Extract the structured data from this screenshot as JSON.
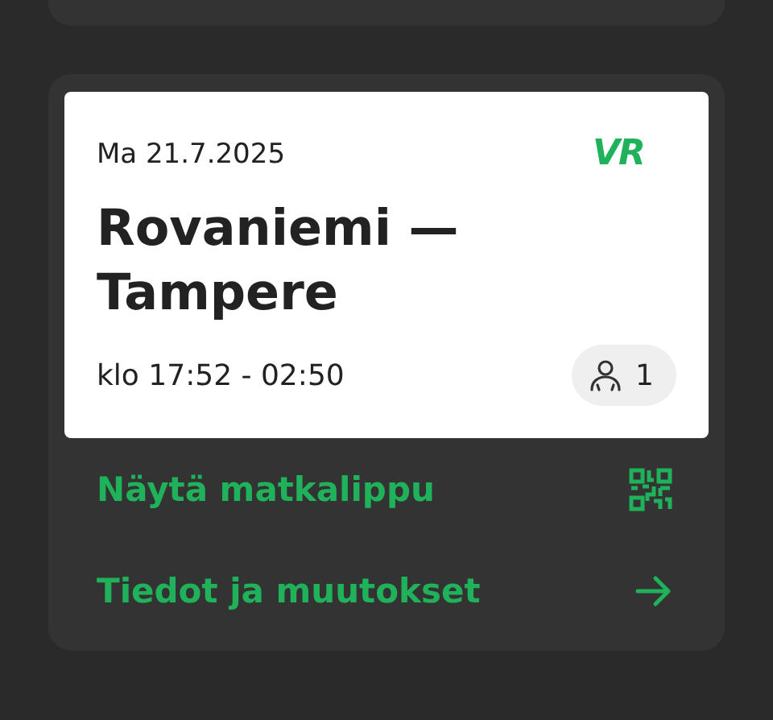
{
  "ticket": {
    "date": "Ma 21.7.2025",
    "logo": "VR",
    "route": "Rovaniemi — Tampere",
    "time": "klo 17:52 - 02:50",
    "passengers": "1"
  },
  "actions": [
    {
      "label": "Näytä matkalippu",
      "kind": "qr"
    },
    {
      "label": "Tiedot ja muutokset",
      "kind": "arrow"
    }
  ]
}
